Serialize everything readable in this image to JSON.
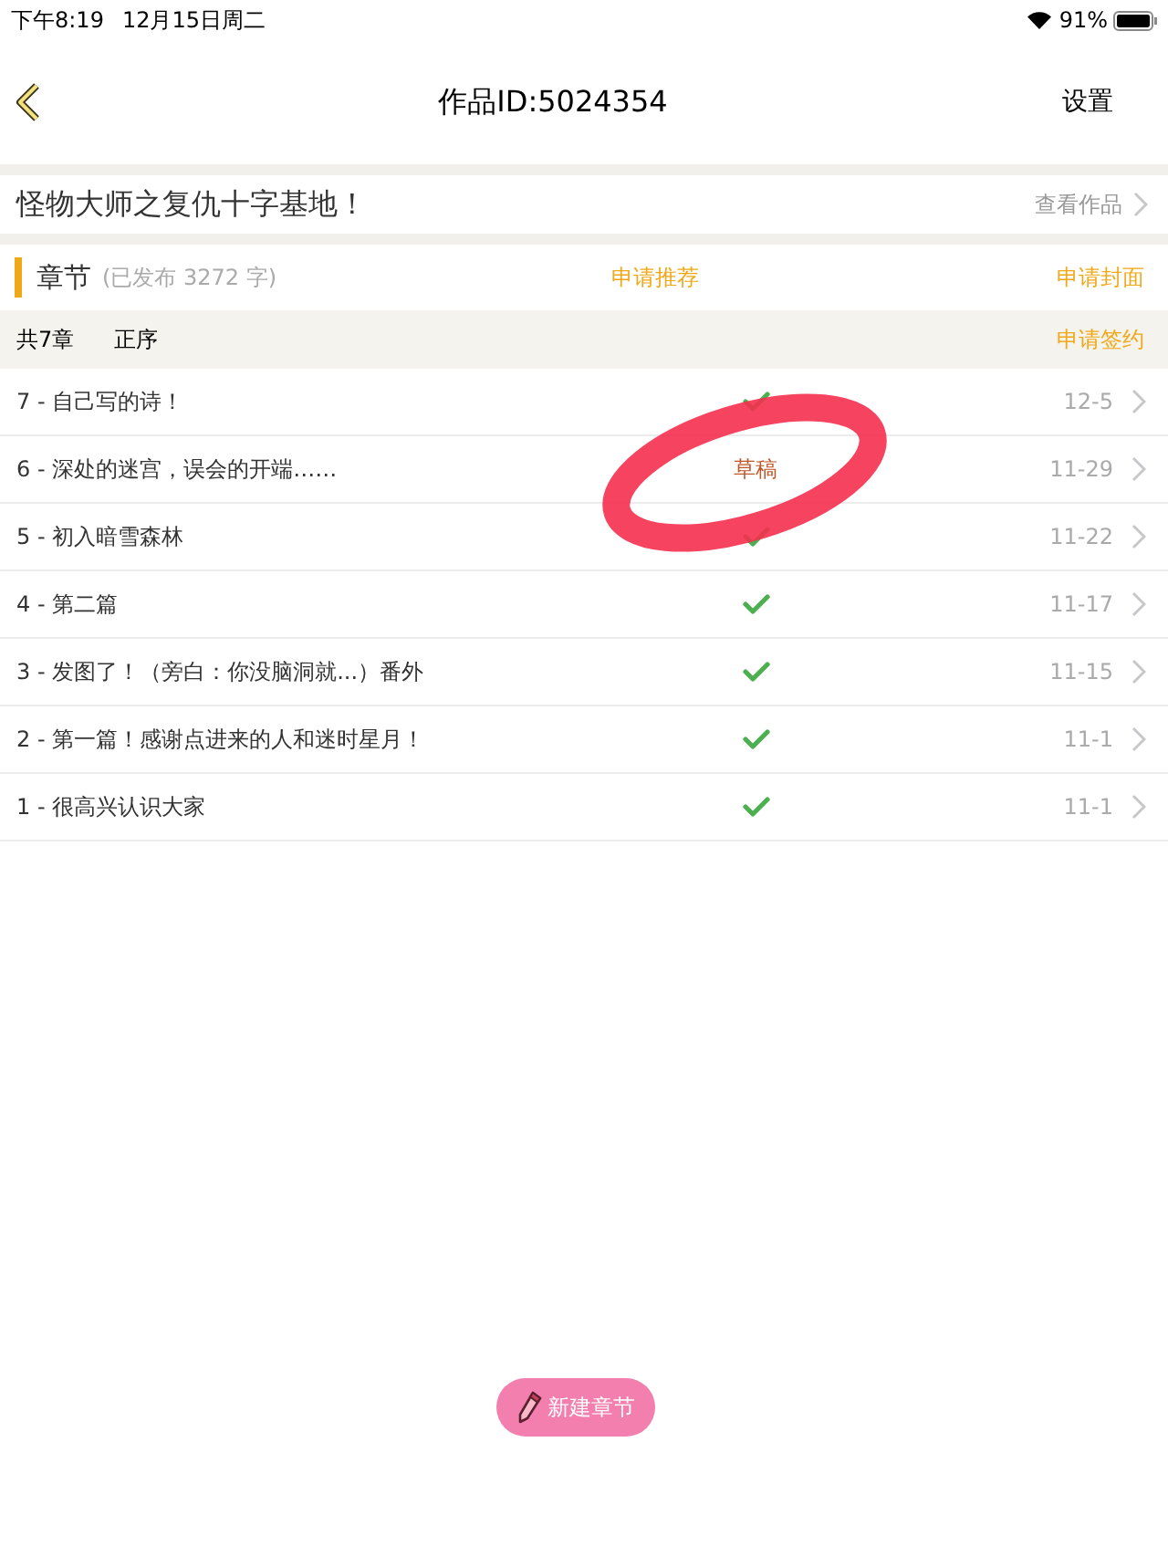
{
  "status_bar": {
    "time": "下午8:19",
    "date": "12月15日周二",
    "battery": "91%"
  },
  "nav": {
    "title": "作品ID:5024354",
    "settings": "设置"
  },
  "work": {
    "title": "怪物大师之复仇十字基地！",
    "link": "查看作品"
  },
  "chapters_header": {
    "title": "章节",
    "count": "(已发布 3272 字)",
    "recommend": "申请推荐",
    "cover": "申请封面"
  },
  "sub_header": {
    "total": "共7章",
    "order": "正序",
    "sign": "申请签约"
  },
  "rows": [
    {
      "title": "7 - 自己写的诗！",
      "kind": "published",
      "date": "12-5"
    },
    {
      "title": "6 - 深处的迷宫，误会的开端……",
      "kind": "draft",
      "status": "草稿",
      "date": "11-29"
    },
    {
      "title": "5 - 初入暗雪森林",
      "kind": "published",
      "date": "11-22"
    },
    {
      "title": "4 - 第二篇",
      "kind": "published",
      "date": "11-17"
    },
    {
      "title": "3 - 发图了！（旁白：你没脑洞就...）番外",
      "kind": "published",
      "date": "11-15"
    },
    {
      "title": "2 - 第一篇！感谢点进来的人和迷时星月！",
      "kind": "published",
      "date": "11-1"
    },
    {
      "title": "1 - 很高兴认识大家",
      "kind": "published",
      "date": "11-1"
    }
  ],
  "new_chapter_button": "新建章节"
}
